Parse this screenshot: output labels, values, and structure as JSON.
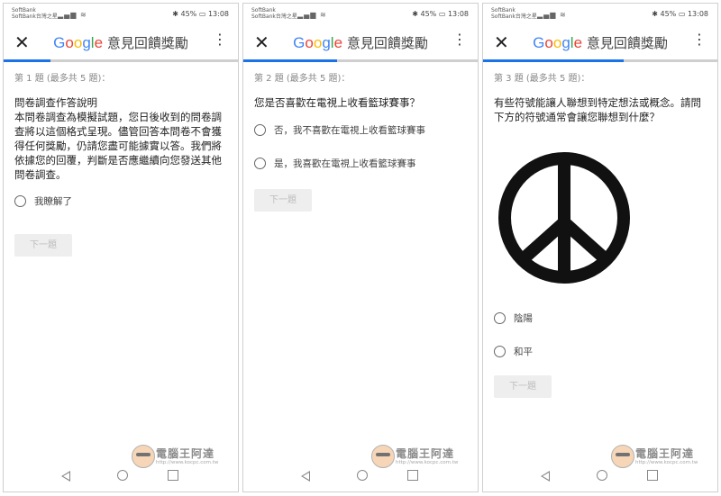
{
  "status": {
    "carrier_top": "SoftBank",
    "carrier_bottom": "SoftBank台灣之星",
    "battery": "45%",
    "time": "13:08"
  },
  "app": {
    "title_brand": "Google",
    "title_text": "意見回饋獎勵",
    "accent_color": "#1a73e8"
  },
  "screens": [
    {
      "progress": 0.2,
      "question_number": "第 1 題 (最多共 5 題)：",
      "question_title": "問卷調查作答說明",
      "question_body": "本問卷調查為模擬試題，您日後收到的問卷調查將以這個格式呈現。儘管回答本問卷不會獲得任何獎勵，仍請您盡可能據實以答。我們將依據您的回覆，判斷是否應繼續向您發送其他問卷調查。",
      "options": [
        "我瞭解了"
      ],
      "next_label": "下一題"
    },
    {
      "progress": 0.4,
      "question_number": "第 2 題 (最多共 5 題)：",
      "question_body": "您是否喜歡在電視上收看籃球賽事？",
      "options": [
        "否，我不喜歡在電視上收看籃球賽事",
        "是，我喜歡在電視上收看籃球賽事"
      ],
      "next_label": "下一題"
    },
    {
      "progress": 0.6,
      "question_number": "第 3 題 (最多共 5 題)：",
      "question_body": "有些符號能讓人聯想到特定想法或概念。請問下方的符號通常會讓您聯想到什麼？",
      "image_icon": "peace-symbol-icon",
      "options": [
        "陰陽",
        "和平"
      ],
      "next_label": "下一題"
    }
  ],
  "watermark": {
    "text": "電腦王阿達",
    "url": "http://www.kocpc.com.tw"
  }
}
